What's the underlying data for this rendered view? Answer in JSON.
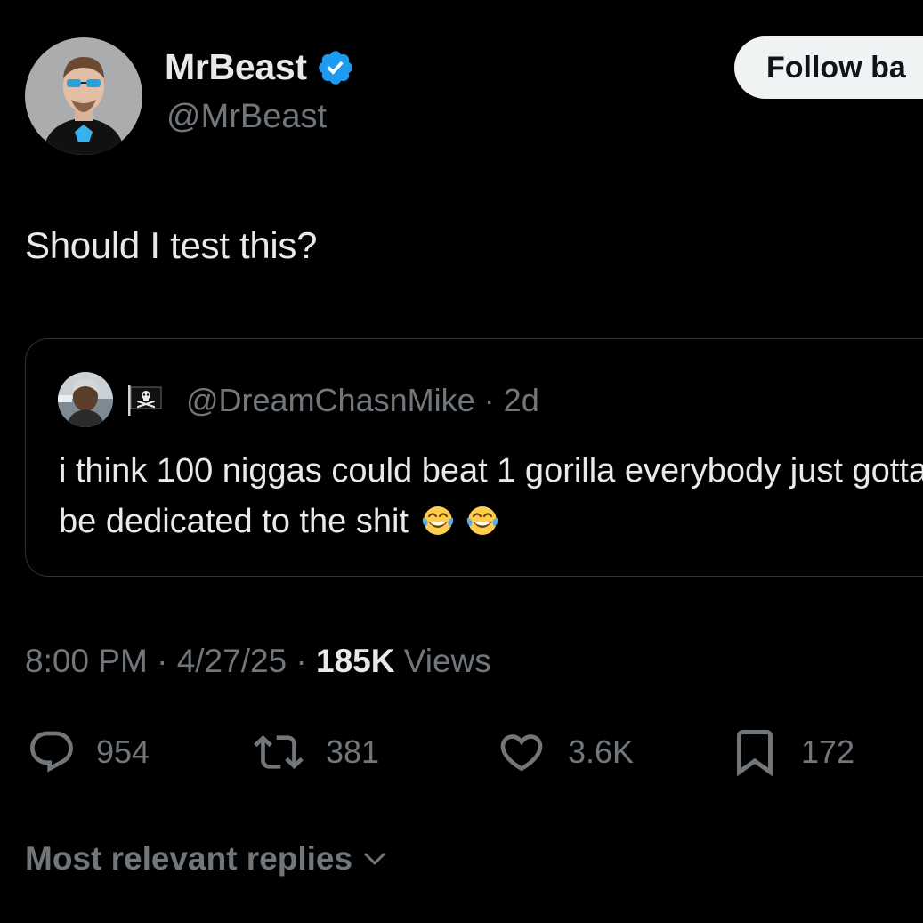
{
  "author": {
    "name": "MrBeast",
    "handle": "@MrBeast",
    "verified": true,
    "avatar_icon": "profile-photo"
  },
  "follow_button": {
    "label": "Follow ba"
  },
  "tweet": {
    "text": "Should I test this?"
  },
  "quoted_tweet": {
    "handle": "@DreamChasnMike",
    "separator": "·",
    "age": "2d",
    "flag_icon": "pirate-flag",
    "text": "i think 100 niggas could beat 1 gorilla everybody just gotta be dedicated to the shit",
    "trailing_emoji": [
      "tears-of-joy-emoji",
      "tears-of-joy-emoji"
    ]
  },
  "meta": {
    "time": "8:00 PM",
    "dot1": "·",
    "date": "4/27/25",
    "dot2": "·",
    "views_count": "185K",
    "views_label": "Views"
  },
  "actions": {
    "replies": "954",
    "reposts": "381",
    "likes": "3.6K",
    "bookmarks": "172"
  },
  "replies_sort": {
    "label": "Most relevant replies"
  },
  "colors": {
    "background": "#000000",
    "primary_text": "#e7e9ea",
    "secondary_text": "#71767b",
    "verified_badge": "#1d9bf0",
    "border": "#2f3336",
    "button_bg": "#eff3f4"
  }
}
